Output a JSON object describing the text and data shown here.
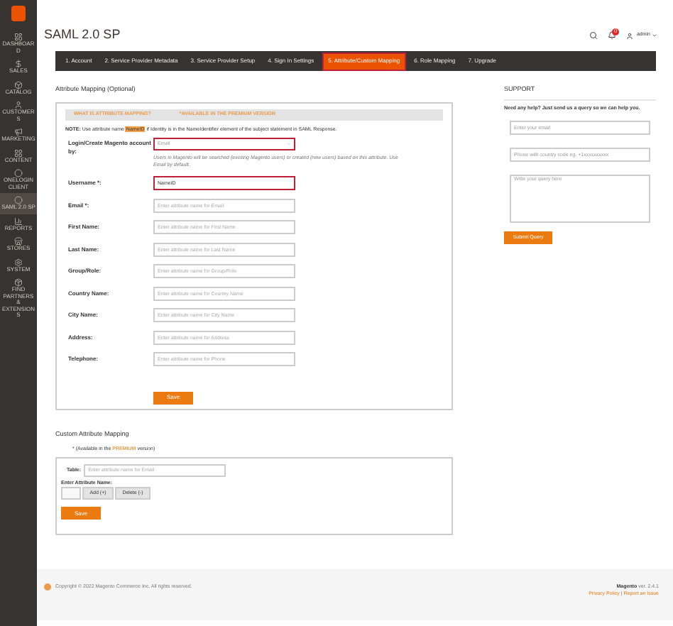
{
  "sidebar": {
    "items": [
      {
        "label": "DASHBOARD",
        "selected": false
      },
      {
        "label": "SALES",
        "selected": false
      },
      {
        "label": "CATALOG",
        "selected": false
      },
      {
        "label": "CUSTOMERS",
        "selected": false
      },
      {
        "label": "MARKETING",
        "selected": false
      },
      {
        "label": "CONTENT",
        "selected": false
      },
      {
        "label": "ONELOGIN CLIENT",
        "selected": false
      },
      {
        "label": "SAML 2.0 SP",
        "selected": true
      },
      {
        "label": "REPORTS",
        "selected": false
      },
      {
        "label": "STORES",
        "selected": false
      },
      {
        "label": "SYSTEM",
        "selected": false
      },
      {
        "label": "FIND PARTNERS & EXTENSIONS",
        "selected": false
      }
    ]
  },
  "page_title": "SAML 2.0 SP",
  "header": {
    "notifications": "0",
    "user": "admin"
  },
  "tabs": [
    {
      "label": "1. Account",
      "selected": false
    },
    {
      "label": "2. Service Provider Metadata",
      "selected": false
    },
    {
      "label": "3. Service Provider Setup",
      "selected": false
    },
    {
      "label": "4. Sign In Settings",
      "selected": false
    },
    {
      "label": "5. Attribute/Custom Mapping",
      "selected": true
    },
    {
      "label": "6. Role Mapping",
      "selected": false
    },
    {
      "label": "7. Upgrade",
      "selected": false
    }
  ],
  "attribute_mapping": {
    "title": "Attribute Mapping (Optional)",
    "banner": [
      "WHAT IS ATTRIBUTE MAPPING?",
      "*AVAILABLE IN THE PREMIUM VERSION"
    ],
    "note": {
      "before": "**NOTE:** Use attribute name",
      "highlight": "NameID",
      "after": "if Identity is in the NameIdentifier element of the subject statement in SAML Response."
    },
    "login_by": {
      "label": "Login/Create Magento account by:",
      "value": "Email",
      "help": "Users in Magento will be searched (existing Magento users) or created (new users) based on this attribute. Use Email by default."
    },
    "fields": [
      {
        "label": "Username *:",
        "value": "NameID",
        "highlighted": true
      },
      {
        "label": "Email *:",
        "placeholder": "Enter attribute name for Email",
        "highlighted": false
      },
      {
        "label": "First Name:",
        "placeholder": "Enter attribute name for First Name",
        "highlighted": false
      },
      {
        "label": "Last Name:",
        "placeholder": "Enter attribute name for Last Name",
        "highlighted": false
      },
      {
        "label": "Group/Role:",
        "placeholder": "Enter attribute name for Group/Role",
        "highlighted": false
      },
      {
        "label": "Country Name:",
        "placeholder": "Enter attribute name for Country Name",
        "highlighted": false
      },
      {
        "label": "City Name:",
        "placeholder": "Enter attribute name for City Name",
        "highlighted": false
      },
      {
        "label": "Address:",
        "placeholder": "Enter attribute name for Address",
        "highlighted": false
      },
      {
        "label": "Telephone:",
        "placeholder": "Enter attribute name for Phone",
        "highlighted": false
      }
    ],
    "save": "Save"
  },
  "custom_mapping": {
    "title": "Custom Attribute Mapping",
    "note": {
      "before": "* (Available in the",
      "highlight": "PREMIUM",
      "after": "version)"
    },
    "table_label": "Table:",
    "table_placeholder": "Enter attribute name for Email",
    "attr_label": "Enter Attribute Name:",
    "add": "Add (+)",
    "delete": "Delete (-)",
    "save": "Save"
  },
  "support": {
    "title": "SUPPORT",
    "text": "Need any help? Just send us a query so we can help you.",
    "email_placeholder": "Enter your email",
    "phone_placeholder": "Phone with country code eg. +1xxxxxxxxxx",
    "query_placeholder": "Write your query here",
    "submit": "Submit Query"
  },
  "footer": {
    "copyright": "Copyright © 2022 Magento Commerce Inc. All rights reserved.",
    "brand": "Magento",
    "version": "ver. 2.4.1",
    "links": [
      "Privacy Policy",
      "Report an Issue"
    ],
    "separator": "|"
  }
}
